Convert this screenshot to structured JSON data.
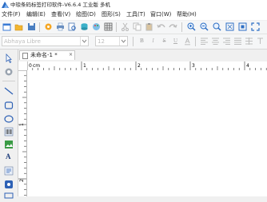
{
  "window": {
    "title": "中琅条码标签打印软件-V6.6.4 工业版 多机"
  },
  "menu": [
    {
      "label": "文件(F)"
    },
    {
      "label": "编辑(E)"
    },
    {
      "label": "查看(V)"
    },
    {
      "label": "绘图(D)"
    },
    {
      "label": "图形(S)"
    },
    {
      "label": "工具(T)"
    },
    {
      "label": "窗口(W)"
    },
    {
      "label": "帮助(H)"
    }
  ],
  "format_bar": {
    "font_name": "Abhaya Libre",
    "font_size": "12",
    "bold": "B",
    "italic": "I",
    "strike": "S",
    "underline": "U"
  },
  "tabs": [
    {
      "label": "未命名-1 *",
      "close": "×"
    }
  ],
  "ruler": {
    "unit": "cm",
    "top_ticks": [
      "0",
      "1",
      "2",
      "3",
      "4"
    ],
    "left_ticks": [
      "1",
      "2"
    ]
  },
  "colors": {
    "accent": "#1e6fd9",
    "canvas": "#ffffff",
    "chrome": "#f0f0f0"
  }
}
